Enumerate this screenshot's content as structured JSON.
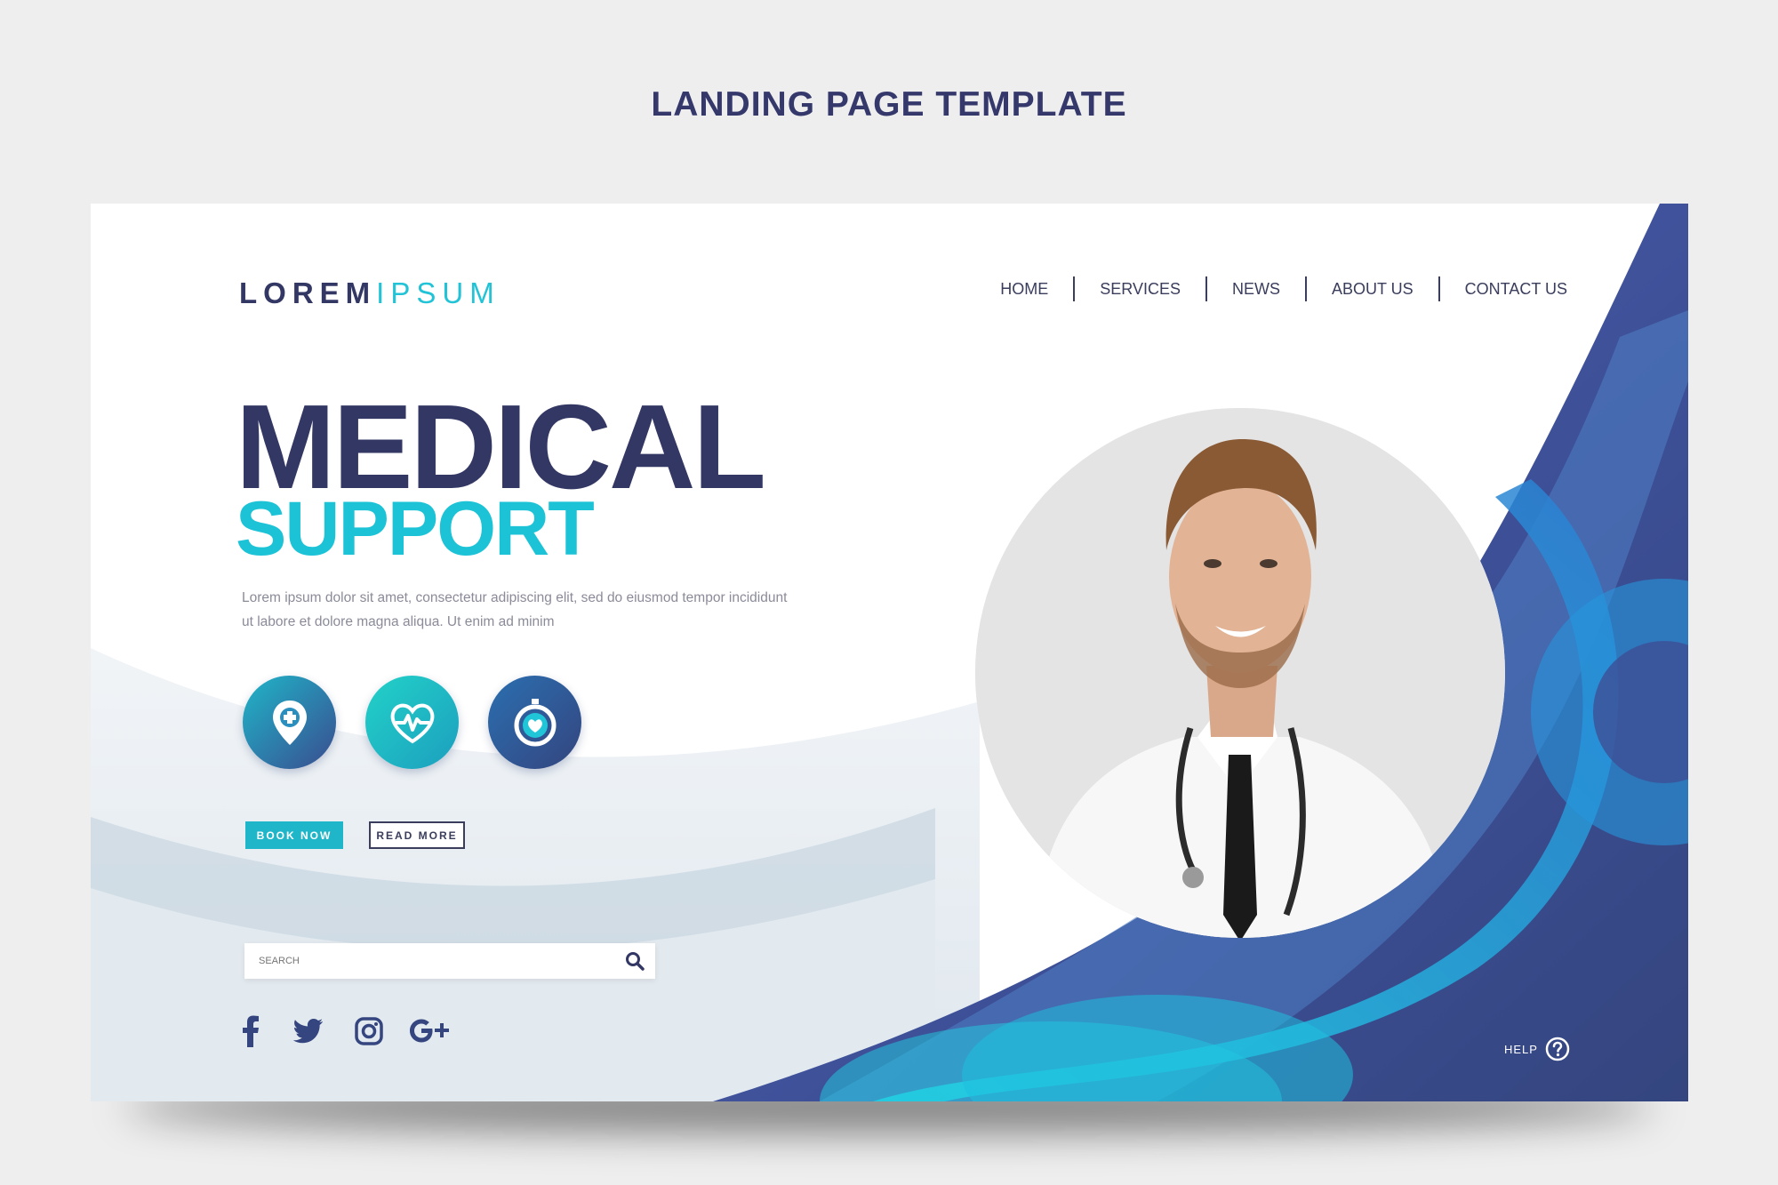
{
  "page": {
    "heading": "LANDING PAGE TEMPLATE"
  },
  "logo": {
    "part1": "LOREM",
    "part2": "IPSUM"
  },
  "nav": {
    "items": [
      {
        "label": "HOME"
      },
      {
        "label": "SERVICES"
      },
      {
        "label": "NEWS"
      },
      {
        "label": "ABOUT US"
      },
      {
        "label": "CONTACT US"
      }
    ]
  },
  "hero": {
    "title": "MEDICAL",
    "subtitle": "SUPPORT",
    "body": "Lorem ipsum dolor sit amet, consectetur adipiscing elit, sed do eiusmod tempor incididunt ut labore et dolore magna aliqua. Ut enim ad minim"
  },
  "features": [
    {
      "icon": "location-pin-cross-icon"
    },
    {
      "icon": "heart-pulse-icon"
    },
    {
      "icon": "stopwatch-heart-icon"
    }
  ],
  "buttons": {
    "book": "BOOK NOW",
    "read": "READ MORE"
  },
  "search": {
    "placeholder": "SEARCH"
  },
  "social": [
    "facebook-icon",
    "twitter-icon",
    "instagram-icon",
    "google-plus-icon"
  ],
  "help": {
    "label": "HELP"
  },
  "colors": {
    "navy": "#333764",
    "teal": "#1cc3d6",
    "blue": "#3f5aa8",
    "bg": "#eeeeee"
  }
}
